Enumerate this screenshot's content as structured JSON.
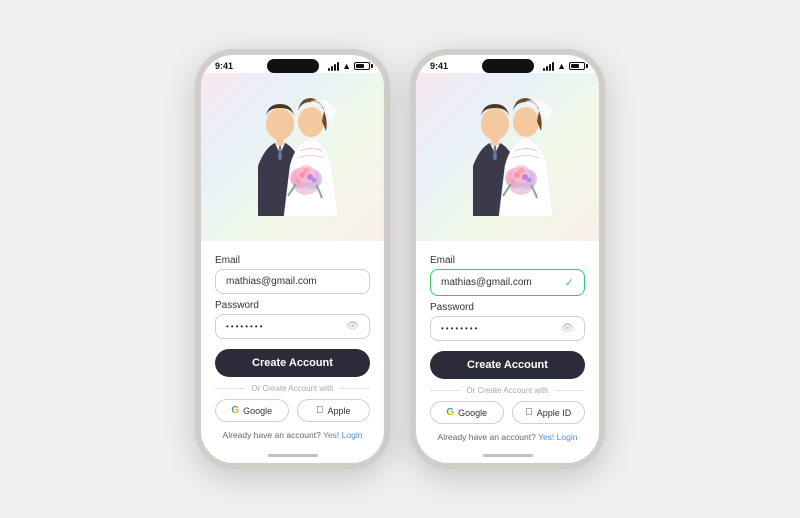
{
  "phones": [
    {
      "id": "phone-left",
      "status_time": "9:41",
      "email_label": "Email",
      "email_value": "mathias@gmail.com",
      "password_label": "Password",
      "password_value": "••••••••",
      "email_active": false,
      "create_btn_label": "Create Account",
      "divider_text": "Or Create Account with",
      "google_label": "Google",
      "apple_label": "Apple",
      "login_text": "Already have an account?",
      "login_link": "Yes! Login"
    },
    {
      "id": "phone-right",
      "status_time": "9:41",
      "email_label": "Email",
      "email_value": "mathias@gmail.com",
      "password_label": "Password",
      "password_value": "••••••••",
      "email_active": true,
      "create_btn_label": "Create Account",
      "divider_text": "Or Create Account with",
      "google_label": "Google",
      "apple_label": "Apple ID",
      "login_text": "Already have an account?",
      "login_link": "Yes! Login"
    }
  ]
}
